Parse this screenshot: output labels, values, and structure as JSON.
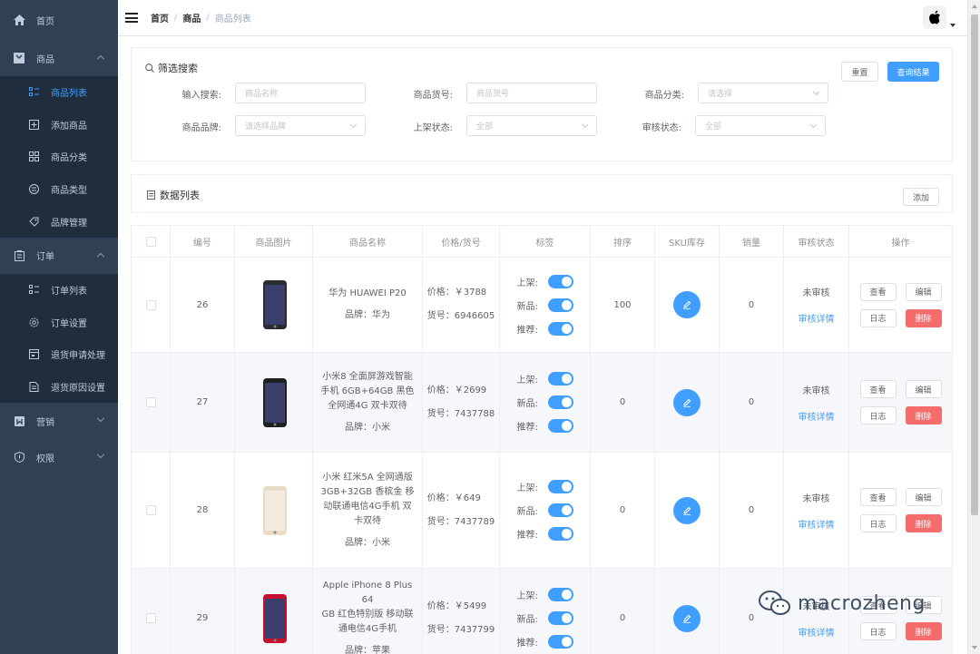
{
  "sidebar": {
    "home": "首页",
    "product": {
      "label": "商品",
      "children": [
        "商品列表",
        "添加商品",
        "商品分类",
        "商品类型",
        "品牌管理"
      ]
    },
    "order": {
      "label": "订单",
      "children": [
        "订单列表",
        "订单设置",
        "退货申请处理",
        "退货原因设置"
      ]
    },
    "marketing": "营销",
    "permission": "权限"
  },
  "breadcrumb": {
    "level1": "首页",
    "level2": "商品",
    "level3": "商品列表"
  },
  "filter": {
    "title": "筛选搜索",
    "reset": "重置",
    "query": "查询结果",
    "keyword_label": "输入搜索:",
    "keyword_placeholder": "商品名称",
    "sn_label": "商品货号:",
    "sn_placeholder": "商品货号",
    "category_label": "商品分类:",
    "category_placeholder": "请选择",
    "brand_label": "商品品牌:",
    "brand_placeholder": "请选择品牌",
    "publish_label": "上架状态:",
    "publish_value": "全部",
    "verify_label": "审核状态:",
    "verify_value": "全部"
  },
  "datalist": {
    "title": "数据列表",
    "add": "添加"
  },
  "table": {
    "headers": [
      "编号",
      "商品图片",
      "商品名称",
      "价格/货号",
      "标签",
      "排序",
      "SKU库存",
      "销量",
      "审核状态",
      "操作"
    ],
    "tag_labels": [
      "上架:",
      "新品:",
      "推荐:"
    ],
    "view_btn": "查看",
    "edit_btn": "编辑",
    "log_btn": "日志",
    "delete_btn": "删除",
    "rows": [
      {
        "id": "26",
        "name_lines": [
          "华为 HUAWEI P20"
        ],
        "brand": "品牌：华为",
        "price": "价格：￥3788",
        "sn": "货号：6946605",
        "sort": "100",
        "sales": "0",
        "status": "未审核",
        "detail": "审核详情",
        "phone_color": "#2b2b33"
      },
      {
        "id": "27",
        "name_lines": [
          "小米8 全面屏游戏智能",
          "手机 6GB+64GB 黑色",
          "全网通4G 双卡双待"
        ],
        "brand": "品牌：小米",
        "price": "价格：￥2699",
        "sn": "货号：7437788",
        "sort": "0",
        "sales": "0",
        "status": "未审核",
        "detail": "审核详情",
        "phone_color": "#1f1f22"
      },
      {
        "id": "28",
        "name_lines": [
          "小米 红米5A 全网通版",
          "3GB+32GB 香槟金 移",
          "动联通电信4G手机 双",
          "卡双待"
        ],
        "brand": "品牌：小米",
        "price": "价格：￥649",
        "sn": "货号：7437789",
        "sort": "0",
        "sales": "0",
        "status": "未审核",
        "detail": "审核详情",
        "phone_color": "#e8dcc6"
      },
      {
        "id": "29",
        "name_lines": [
          "Apple iPhone 8 Plus 64",
          "GB 红色特别版 移动联",
          "通电信4G手机"
        ],
        "brand": "品牌：苹果",
        "price": "价格：￥5499",
        "sn": "货号：7437799",
        "sort": "0",
        "sales": "0",
        "status": "未审核",
        "detail": "审核详情",
        "phone_color": "#c8102e"
      }
    ]
  },
  "watermark": "macrozheng",
  "colors": {
    "sidebar_bg": "#304156",
    "submenu_bg": "#1f2d3d",
    "primary": "#409eff",
    "danger": "#f56c6c"
  }
}
